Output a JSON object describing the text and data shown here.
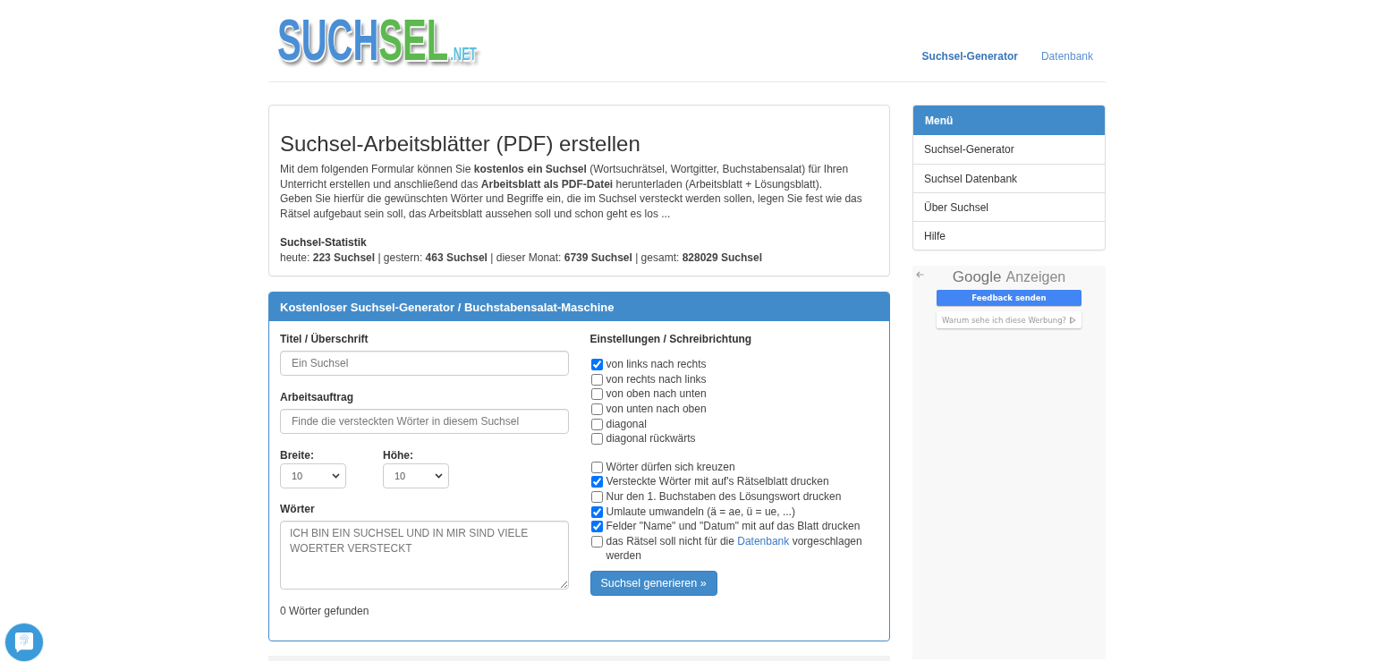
{
  "header": {
    "logo": {
      "parts": [
        {
          "text": "SUCH",
          "color": "#4a8fd6"
        },
        {
          "text": "SEL",
          "color": "#5cb84f"
        }
      ],
      "suffix": ".NET"
    },
    "nav": [
      {
        "label": "Suchsel-Generator",
        "selected": true
      },
      {
        "label": "Datenbank",
        "selected": false
      }
    ]
  },
  "intro": {
    "title": "Suchsel-Arbeitsblätter (PDF) erstellen",
    "paragraphs": [
      "Mit dem folgenden Formular können Sie **kostenlos ein Suchsel** (Wortsuchrätsel, Wortgitter, Buchstabensalat) für Ihren Unterricht erstellen und anschließend das **Arbeitsblatt als PDF-Datei** herunterladen (Arbeitsblatt + Lösungsblatt).",
      "Geben Sie hierfür die gewünschten Wörter und Begriffe ein, die im Suchsel versteckt werden sollen, legen Sie fest wie das Rätsel aufgebaut sein soll, das Arbeitsblatt aussehen soll und schon geht es los ..."
    ],
    "stats_title": "Suchsel-Statistik",
    "stats": "heute: **223 Suchsel** | gestern: **463 Suchsel** | dieser Monat: **6739 Suchsel** | gesamt: **828029 Suchsel**"
  },
  "generator": {
    "title": "Kostenloser Suchsel-Generator / Buchstabensalat-Maschine",
    "fields": [
      {
        "label": "Titel / Überschrift",
        "placeholder": "Ein Suchsel"
      },
      {
        "label": "Arbeitsauftrag",
        "placeholder": "Finde die versteckten Wörter in diesem Suchsel"
      }
    ],
    "size_selects": [
      {
        "label": "Breite:",
        "value": "10"
      },
      {
        "label": "Höhe:",
        "value": "10"
      }
    ],
    "words": {
      "label": "Wörter",
      "placeholder": "ICH BIN EIN SUCHSEL UND IN MIR SIND VIELE WOERTER VERSTECKT"
    },
    "word_count": "0 Wörter gefunden",
    "settings": {
      "title": "Einstellungen / Schreibrichtung",
      "groups": [
        [
          {
            "label": "von links nach rechts",
            "checked": true
          },
          {
            "label": "von rechts nach links",
            "checked": false
          },
          {
            "label": "von oben nach unten",
            "checked": false
          },
          {
            "label": "von unten nach oben",
            "checked": false
          },
          {
            "label": "diagonal",
            "checked": false
          },
          {
            "label": "diagonal rückwärts",
            "checked": false
          }
        ],
        [
          {
            "label": "Wörter dürfen sich kreuzen",
            "checked": false
          },
          {
            "label": "Versteckte Wörter mit auf's Rätselblatt drucken",
            "checked": true
          },
          {
            "label": "Nur den 1. Buchstaben des Lösungswort drucken",
            "checked": false
          },
          {
            "label": "Umlaute umwandeln (ä = ae, ü = ue, ...)",
            "checked": true
          },
          {
            "label": "Felder \"Name\" und \"Datum\" mit auf das Blatt drucken",
            "checked": true
          },
          {
            "label": "das Rätsel soll nicht für die",
            "link": "Datenbank",
            "label_after": "vorgeschlagen werden",
            "checked": false
          }
        ]
      ]
    },
    "submit": "Suchsel generieren »"
  },
  "sidebar": {
    "menu_title": "Menü",
    "menu_items": [
      "Suchsel-Generator",
      "Suchsel Datenbank",
      "Über Suchsel",
      "Hilfe"
    ],
    "ad": {
      "brand": "Google",
      "label": "Anzeigen",
      "feedback_button": "Feedback senden",
      "why_button": "Warum sehe ich diese Werbung?"
    }
  }
}
